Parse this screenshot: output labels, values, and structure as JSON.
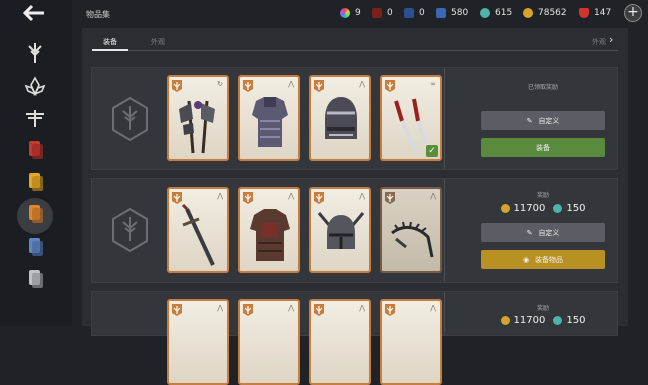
{
  "header": {
    "title": "物品集",
    "currencies": [
      {
        "icon": "multicolor-orb-icon",
        "value": "9",
        "color": "#c9a0dc"
      },
      {
        "icon": "red-gem-icon",
        "value": "0",
        "color": "#c0392b"
      },
      {
        "icon": "blue-shield-icon",
        "value": "0",
        "color": "#3a6fc9"
      },
      {
        "icon": "blue-badge-icon",
        "value": "580",
        "color": "#4a7fd0"
      },
      {
        "icon": "teal-gear-icon",
        "value": "615",
        "color": "#4fb3a6"
      },
      {
        "icon": "gold-coin-icon",
        "value": "78562",
        "color": "#d4a52a"
      },
      {
        "icon": "ruby-icon",
        "value": "147",
        "color": "#d2342f"
      }
    ]
  },
  "tabs": [
    {
      "label": "装备",
      "active": true
    },
    {
      "label": "外观",
      "active": false
    },
    {
      "label": "外观",
      "active": false
    }
  ],
  "sets": [
    {
      "status": "已领取奖励",
      "customize_label": "自定义",
      "action_label": "装备",
      "items": [
        "dual-axe-icon",
        "plate-armor-icon",
        "great-helm-icon",
        "twin-daggers-icon"
      ]
    },
    {
      "price_label": "奖励",
      "price_gold": "11700",
      "price_gear": "150",
      "customize_label": "自定义",
      "action_label": "装备物品",
      "items": [
        "greatsword-icon",
        "leather-armor-icon",
        "horned-helm-icon",
        "spiked-whip-icon"
      ]
    },
    {
      "price_label": "奖励",
      "price_gold": "11700",
      "price_gear": "150"
    }
  ]
}
